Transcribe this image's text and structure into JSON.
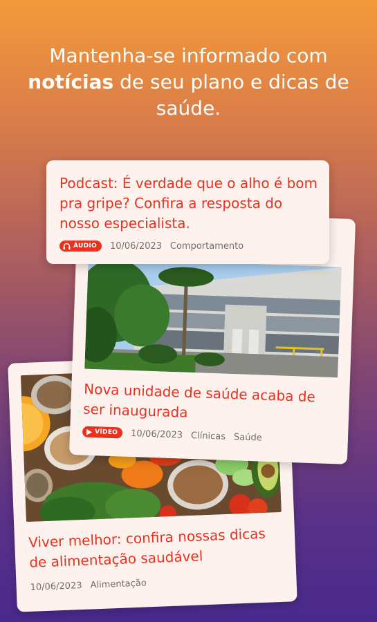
{
  "headline": {
    "part1": "Mantenha-se informado com ",
    "bold": "notícias",
    "part2": " de seu plano e dicas de saúde."
  },
  "cards": [
    {
      "title": "Podcast: É verdade que o alho é bom pra gripe? Confira a resposta do nosso especialista.",
      "badge": "ÁUDIO",
      "badge_icon": "headphones-icon",
      "date": "10/06/2023",
      "tags": [
        "Comportamento"
      ]
    },
    {
      "title": "Nova unidade de saúde acaba de ser inaugurada",
      "badge": "VÍDEO",
      "badge_icon": "play-icon",
      "date": "10/06/2023",
      "tags": [
        "Clínicas",
        "Saúde"
      ]
    },
    {
      "title": "Viver melhor: confira nossas dicas de alimentação saudável",
      "date": "10/06/2023",
      "tags": [
        "Alimentação"
      ]
    }
  ],
  "colors": {
    "accent": "#e8321f",
    "card_bg": "#fdf2ee",
    "gradient_top": "#f39a3a",
    "gradient_bottom": "#4a2a8e"
  }
}
